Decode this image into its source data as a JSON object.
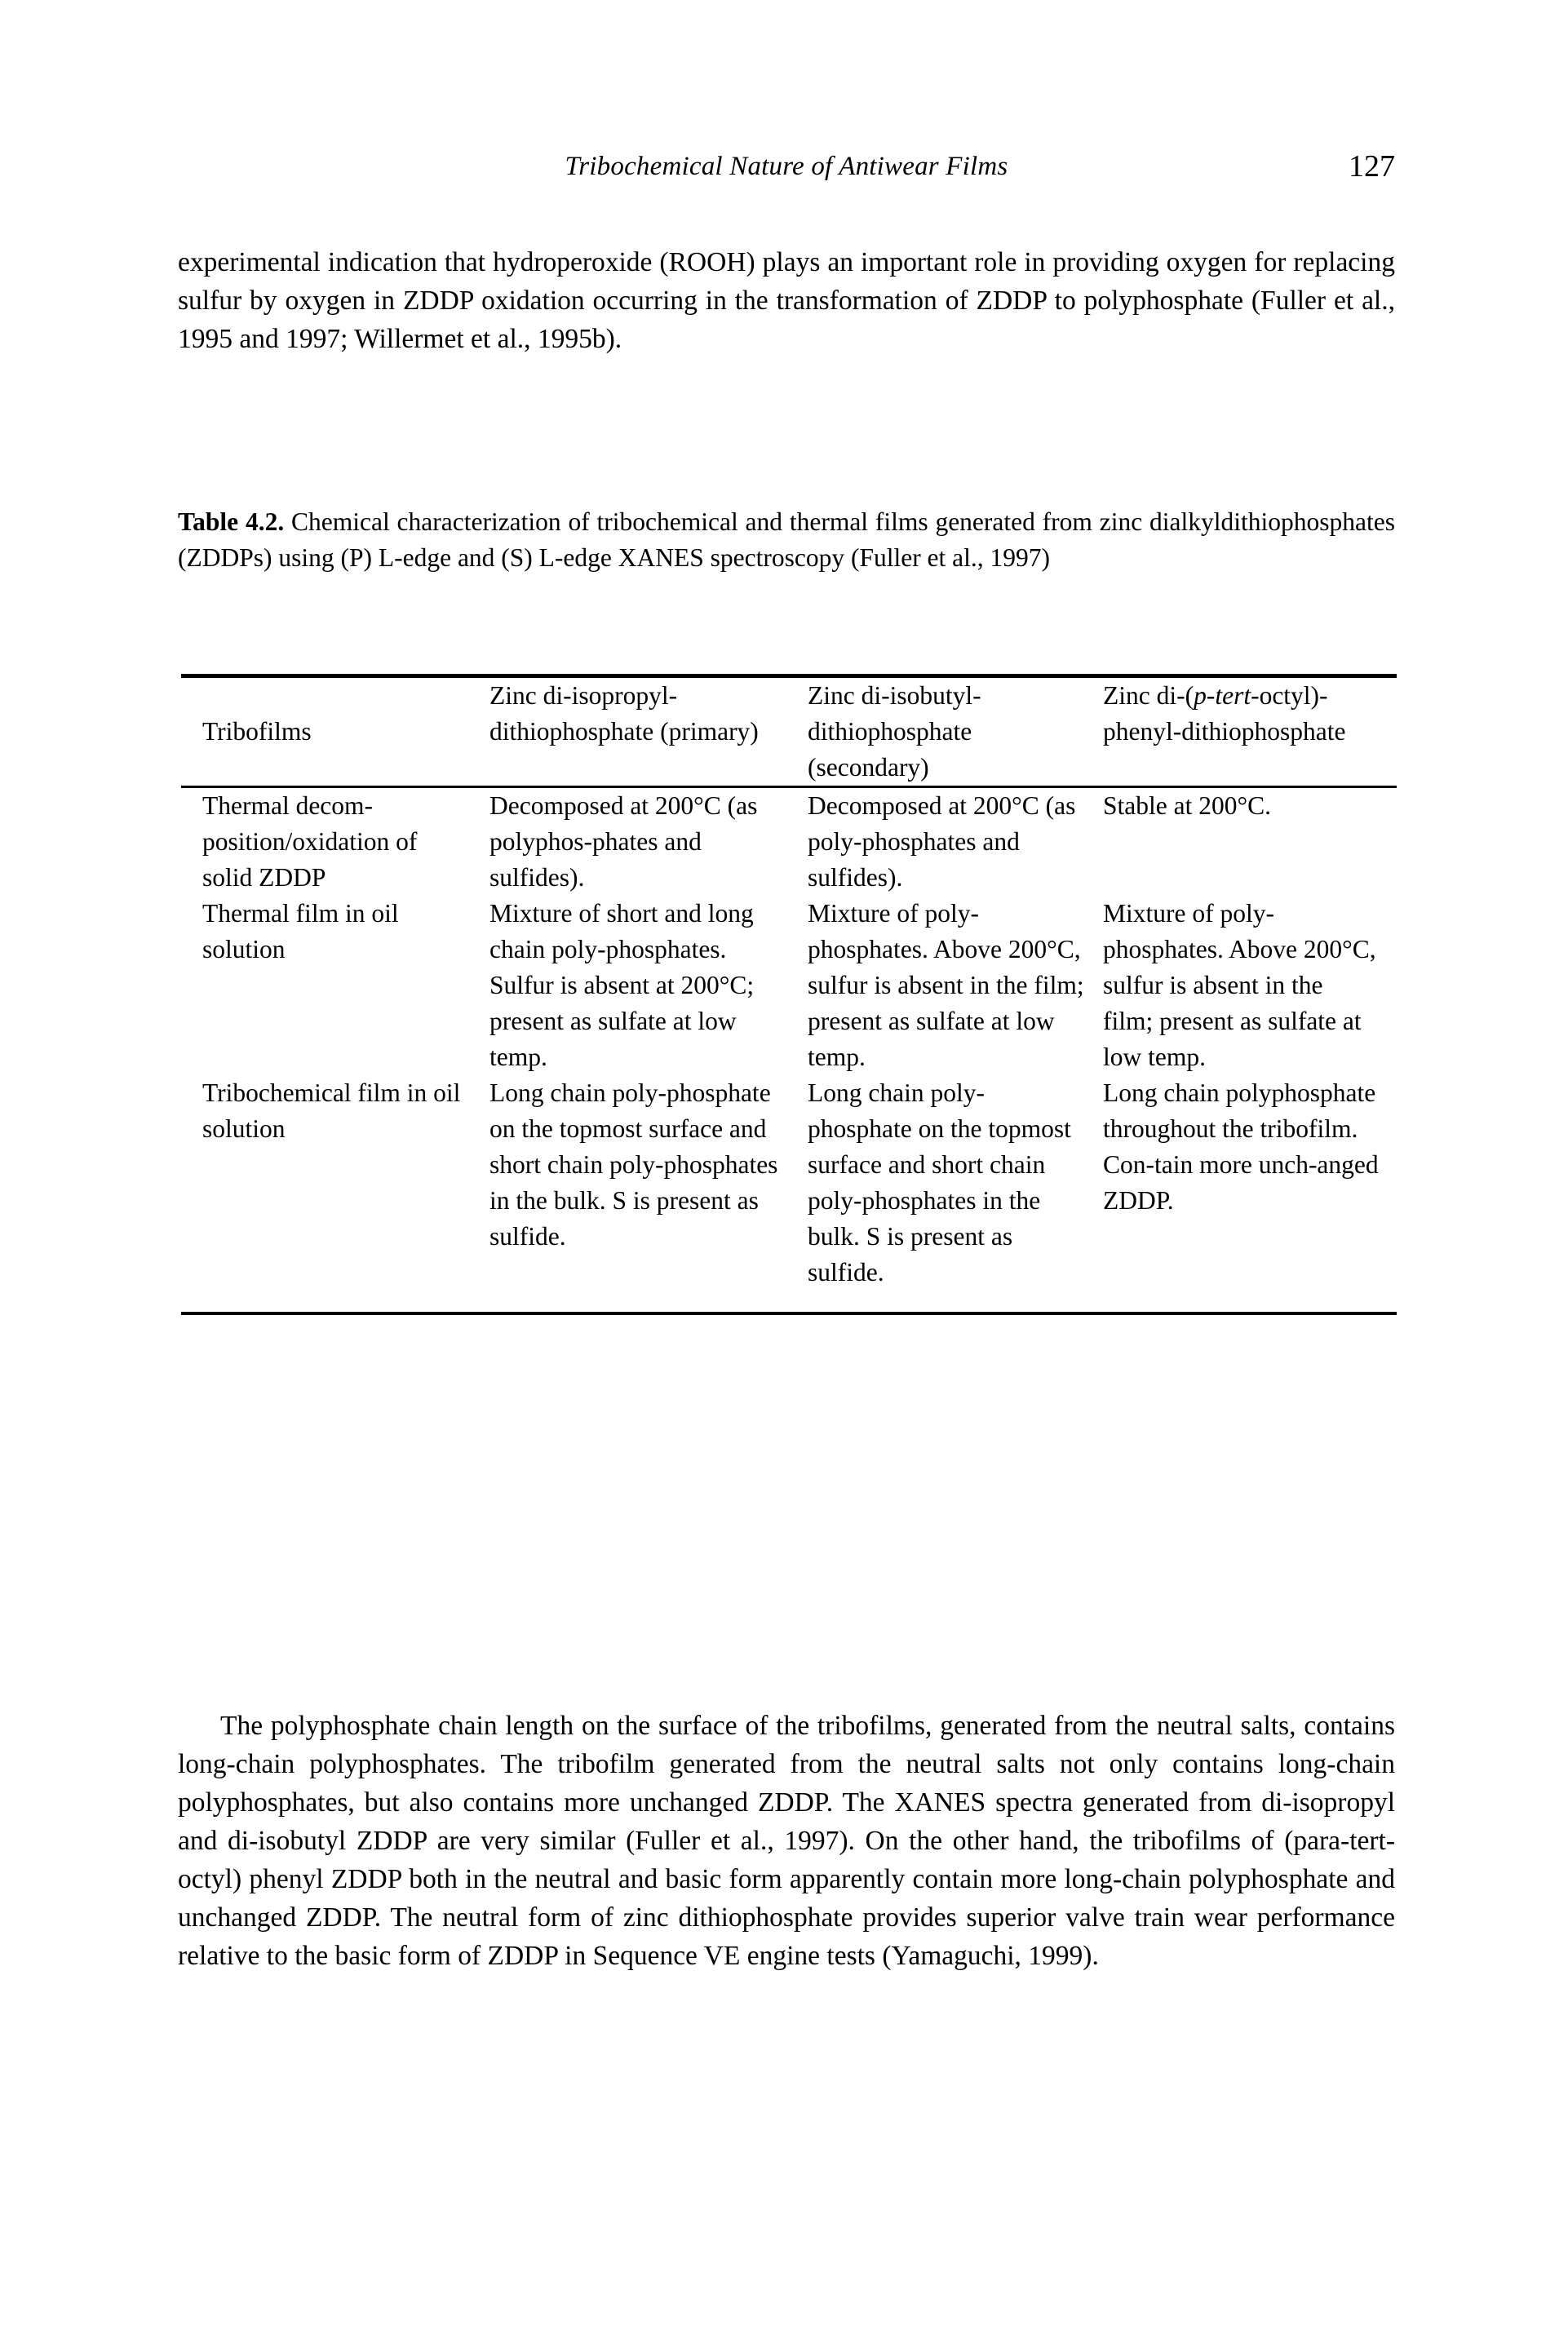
{
  "running_head": {
    "title": "Tribochemical Nature of Antiwear Films",
    "page_number": "127"
  },
  "paragraphs": {
    "top": "experimental indication that hydroperoxide (ROOH) plays an important role in providing oxygen for replacing sulfur by oxygen in ZDDP oxidation occurring in the transformation of ZDDP to polyphosphate (Fuller et al., 1995 and 1997; Willermet et al., 1995b).",
    "bottom": "The polyphosphate chain length on the surface of the tribofilms, generated from the neutral salts, contains long-chain polyphosphates.  The tribofilm generated from the neutral salts not only contains long-chain polyphosphates, but also contains  more unchanged ZDDP.  The XANES spectra generated from di-isopropyl and di-isobutyl ZDDP are very similar (Fuller et al., 1997).  On the other hand, the tribofilms of (para-tert-octyl) phenyl ZDDP both in the neutral and basic form apparently contain more long-chain polyphosphate and unchanged ZDDP.  The neutral form of zinc dithiophosphate provides superior valve train wear performance relative to the basic form of ZDDP in Sequence VE engine tests (Yamaguchi, 1999)."
  },
  "table": {
    "caption_label": "Table 4.2.",
    "caption_text": " Chemical characterization of tribochemical and thermal films generated from zinc dialkyldithiophosphates (ZDDPs) using (P) L-edge and (S) L-edge XANES spectroscopy (Fuller et al., 1997)",
    "headers": {
      "col1": "Tribofilms",
      "col2": "Zinc di-isopropyl-dithiophosphate (primary)",
      "col3": "Zinc di-isobutyl-dithiophosphate (secondary)",
      "col4_part1": "Zinc di-(",
      "col4_italic": "p-tert",
      "col4_part2": "-octyl)-phenyl-dithiophosphate"
    },
    "rows": [
      {
        "label": "Thermal decom-position/oxidation of  solid ZDDP",
        "col2": "Decomposed at 200°C (as polyphos-phates and sulfides).",
        "col3": "Decomposed at 200°C (as poly-phosphates and sulfides).",
        "col4": "Stable at 200°C."
      },
      {
        "label": "Thermal film in oil solution",
        "col2": "Mixture of short and long chain poly-phosphates. Sulfur is absent at  200°C; present as sulfate  at low temp.",
        "col3": "Mixture of poly-phosphates. Above 200°C, sulfur is  absent in the film; present as sulfate at low temp.",
        "col4": "Mixture of poly-phosphates. Above 200°C, sulfur is absent in the film; present as sulfate at low temp."
      },
      {
        "label": "Tribochemical film in oil solution",
        "col2": "Long chain poly-phosphate on the topmost surface and short chain poly-phosphates in the bulk.  S is present as sulfide.",
        "col3": "Long chain poly-phosphate on the topmost surface and short chain poly-phosphates in the bulk.  S is present as sulfide.",
        "col4": "Long chain polyphosphate throughout the tribofilm. Con-tain more unch-anged ZDDP."
      }
    ]
  },
  "colors": {
    "text": "#000000",
    "background": "#ffffff",
    "rule": "#000000"
  }
}
